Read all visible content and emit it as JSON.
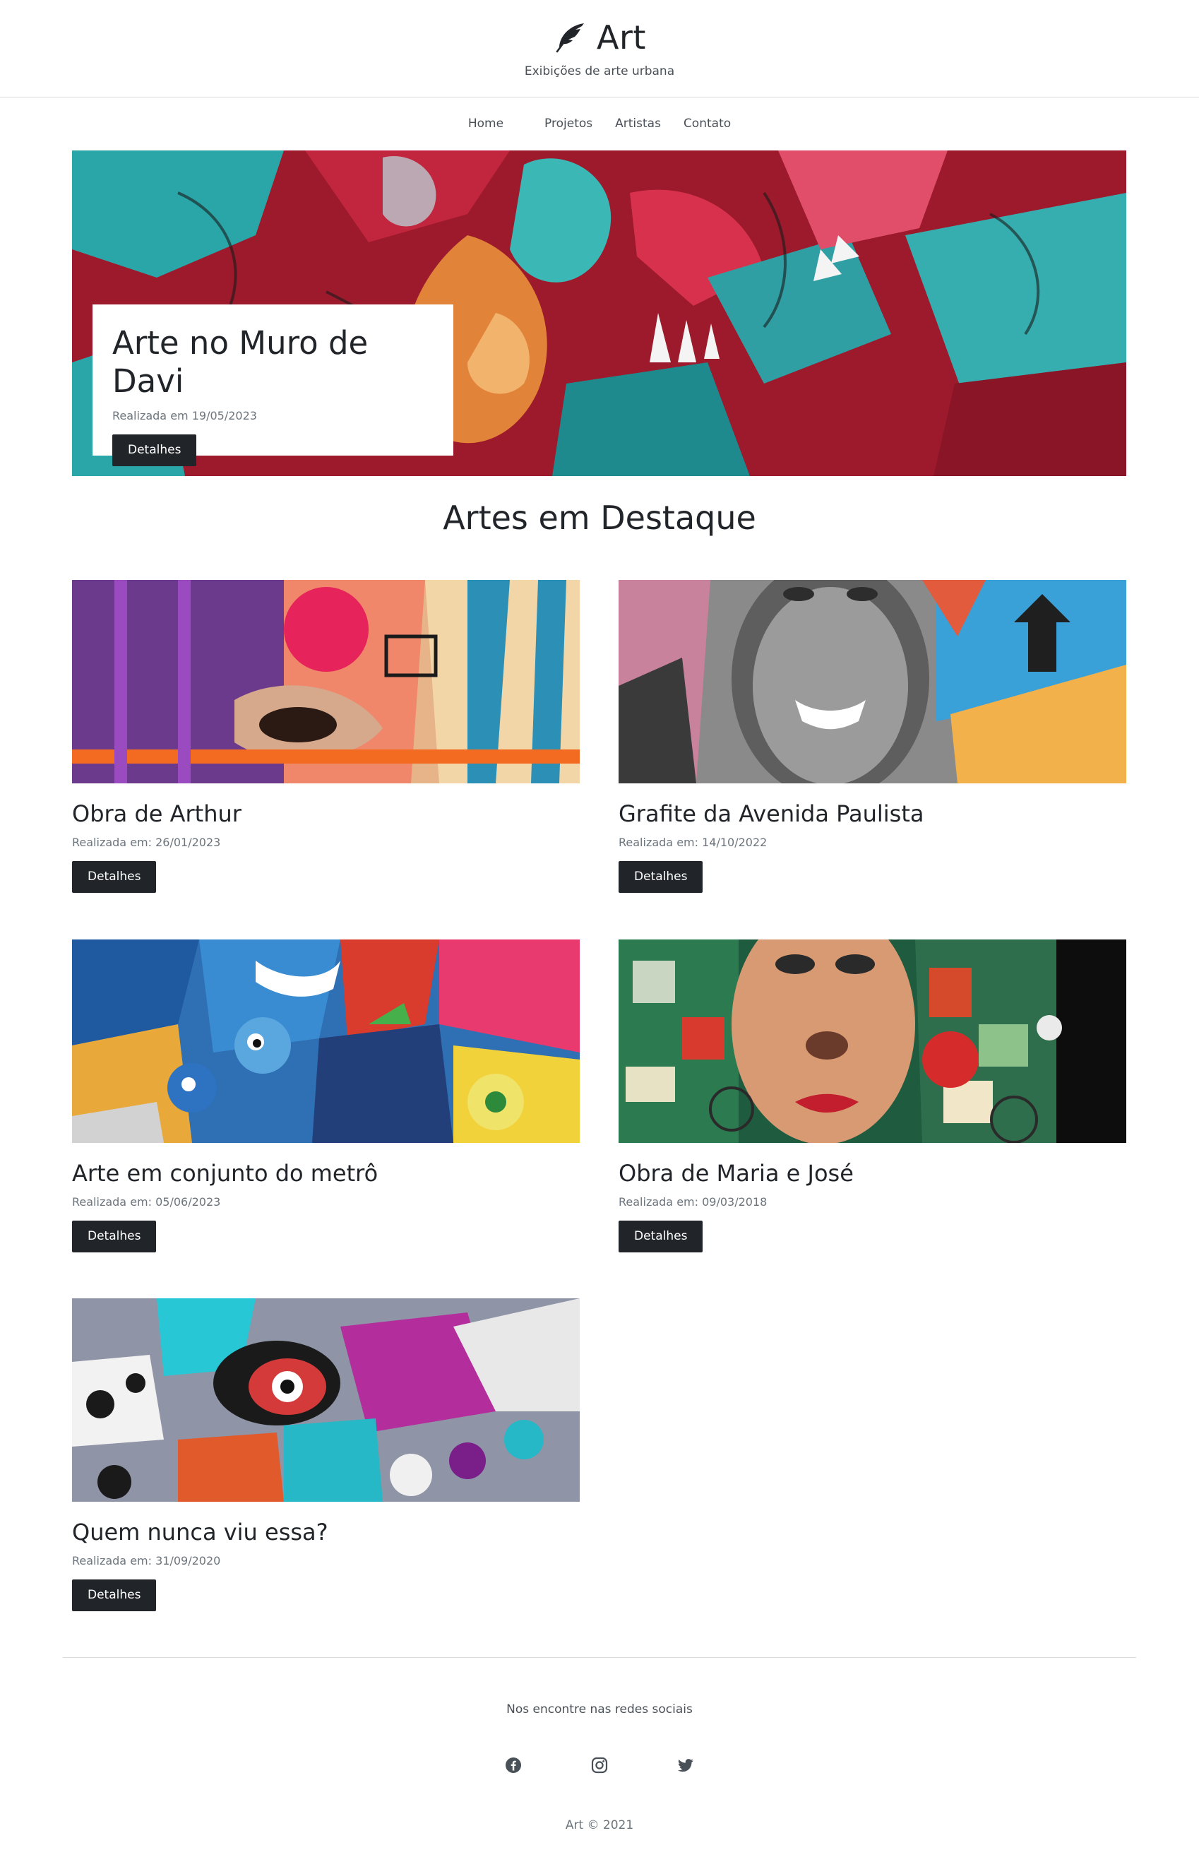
{
  "header": {
    "brand_icon": "feather-icon",
    "brand_title": "Art",
    "tagline": "Exibições de arte urbana"
  },
  "nav": {
    "items": [
      {
        "label": "Home"
      },
      {
        "label": "Projetos"
      },
      {
        "label": "Artistas"
      },
      {
        "label": "Contato"
      }
    ]
  },
  "hero": {
    "title": "Arte no Muro de Davi",
    "date": "Realizada em 19/05/2023",
    "button": "Detalhes"
  },
  "featured": {
    "title": "Artes em Destaque",
    "cards": [
      {
        "title": "Obra de Arthur",
        "date": "Realizada em: 26/01/2023",
        "button": "Detalhes"
      },
      {
        "title": "Grafite da Avenida Paulista",
        "date": "Realizada em: 14/10/2022",
        "button": "Detalhes"
      },
      {
        "title": "Arte em conjunto do metrô",
        "date": "Realizada em: 05/06/2023",
        "button": "Detalhes"
      },
      {
        "title": "Obra de Maria e José",
        "date": "Realizada em: 09/03/2018",
        "button": "Detalhes"
      },
      {
        "title": "Quem nunca viu essa?",
        "date": "Realizada em: 31/09/2020",
        "button": "Detalhes"
      }
    ]
  },
  "footer": {
    "text": "Nos encontre nas redes sociais",
    "socials": [
      "facebook-icon",
      "instagram-icon",
      "twitter-icon"
    ],
    "copyright": "Art © 2021"
  },
  "colors": {
    "dark": "#212529",
    "muted": "#6c757d",
    "rule": "#d8dadd"
  }
}
